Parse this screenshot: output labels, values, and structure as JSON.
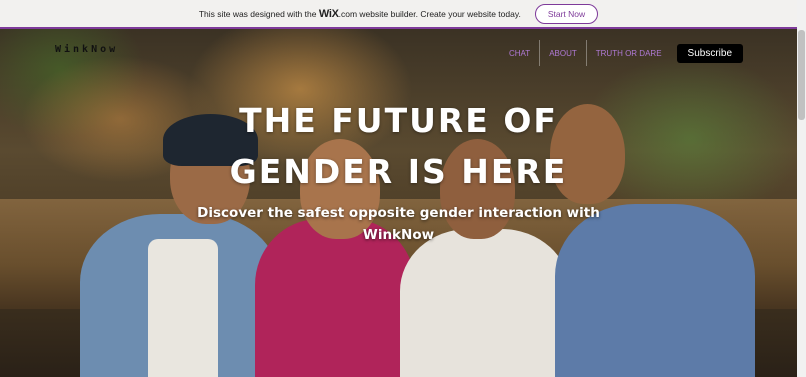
{
  "wix_banner": {
    "text_before": "This site was designed with the",
    "logo": "WiX",
    "text_after": ".com website builder. Create your website today.",
    "button": "Start Now"
  },
  "header": {
    "logo": "WinkNow",
    "nav": [
      "CHAT",
      "ABOUT",
      "TRUTH OR DARE"
    ],
    "subscribe": "Subscribe"
  },
  "hero": {
    "headline_line1": "THE FUTURE OF",
    "headline_line2": "GENDER IS HERE",
    "subhead_line1": "Discover the safest opposite gender interaction with",
    "subhead_line2": "WinkNow"
  },
  "colors": {
    "accent": "#7e3a9a",
    "nav_link": "#b07ad6",
    "subscribe_bg": "#000000"
  }
}
